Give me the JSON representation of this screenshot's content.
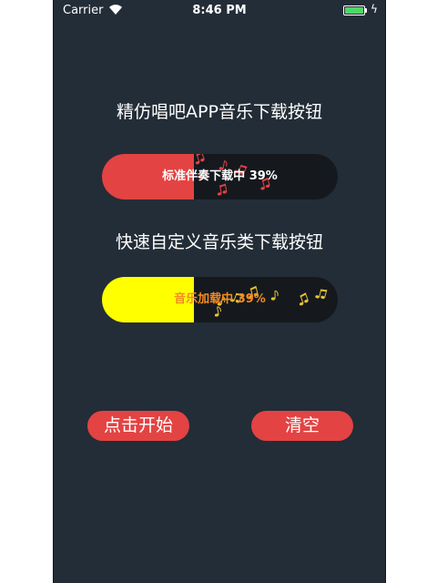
{
  "status_bar": {
    "carrier": "Carrier",
    "time": "8:46 PM",
    "battery_level": 1.0,
    "battery_color": "#4cd964"
  },
  "section1": {
    "title": "精仿唱吧APP音乐下载按钮",
    "progress_text": "标准伴奏下载中 39%",
    "progress": 0.39,
    "fill_color": "#e34343",
    "track_color": "#15191e",
    "text_color": "#ffffff",
    "note_color": "#e34343",
    "icon": "music-note-icon"
  },
  "section2": {
    "title": "快速自定义音乐类下载按钮",
    "progress_text": "音乐加载中 39%",
    "progress": 0.39,
    "fill_color": "#ffff00",
    "track_color": "#15191e",
    "text_color": "#f58a1f",
    "note_color": "#e7c234",
    "icon": "music-note-icon"
  },
  "actions": {
    "start_label": "点击开始",
    "clear_label": "清空",
    "button_color": "#e34343"
  }
}
